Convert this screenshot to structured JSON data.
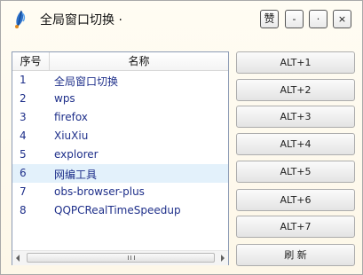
{
  "window": {
    "title": "全局窗口切换 ·",
    "like_label": "赞",
    "min_label": "-",
    "max_label": "·",
    "close_label": "×"
  },
  "list": {
    "columns": [
      "序号",
      "名称"
    ],
    "rows": [
      {
        "num": "1",
        "name": "全局窗口切换"
      },
      {
        "num": "2",
        "name": "wps"
      },
      {
        "num": "3",
        "name": "firefox"
      },
      {
        "num": "4",
        "name": "XiuXiu"
      },
      {
        "num": "5",
        "name": "explorer"
      },
      {
        "num": "6",
        "name": "网编工具"
      },
      {
        "num": "7",
        "name": "obs-browser-plus"
      },
      {
        "num": "8",
        "name": "QQPCRealTimeSpeedup"
      }
    ],
    "selected_row": "6"
  },
  "buttons": {
    "alt1": "ALT+1",
    "alt2": "ALT+2",
    "alt3": "ALT+3",
    "alt4": "ALT+4",
    "alt5": "ALT+5",
    "alt6": "ALT+6",
    "alt7": "ALT+7",
    "refresh": "刷 新"
  },
  "icons": {
    "app": "feather-quill-icon",
    "scroll_left": "arrow-left-icon",
    "scroll_right": "arrow-right-icon",
    "scroll_grip": "grip-icon"
  },
  "colors": {
    "window_bg": "#fdf7e8",
    "list_text": "#1e2f8a",
    "selected_row_bg": "#e3f1fb",
    "list_border": "#8c9bb5"
  }
}
